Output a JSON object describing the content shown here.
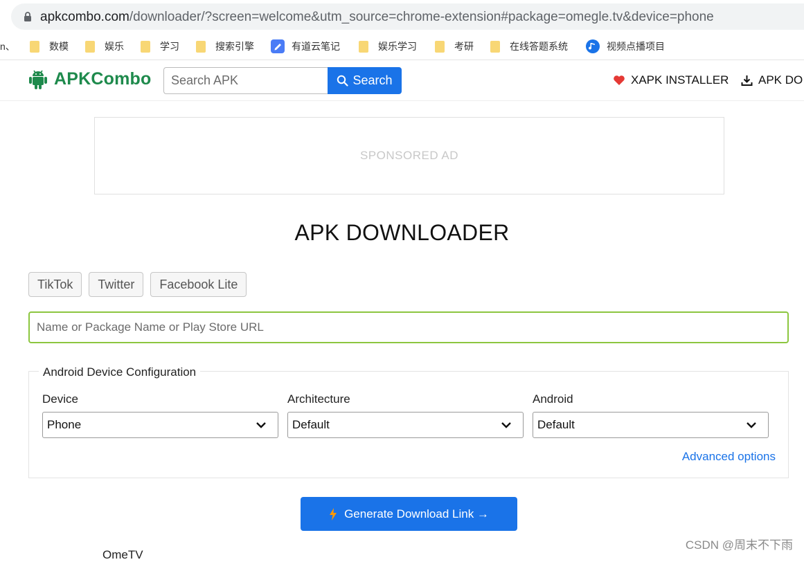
{
  "browser": {
    "url_host": "apkcombo.com",
    "url_rest": "/downloader/?screen=welcome&utm_source=chrome-extension#package=omegle.tv&device=phone",
    "bookmarks_cut": "n、",
    "bookmarks": [
      {
        "label": "数模",
        "icon": "folder-icon"
      },
      {
        "label": "娱乐",
        "icon": "folder-icon"
      },
      {
        "label": "学习",
        "icon": "folder-icon"
      },
      {
        "label": "搜索引擎",
        "icon": "folder-icon"
      },
      {
        "label": "有道云笔记",
        "icon": "note-icon"
      },
      {
        "label": "娱乐学习",
        "icon": "folder-icon"
      },
      {
        "label": "考研",
        "icon": "folder-icon"
      },
      {
        "label": "在线答题系统",
        "icon": "folder-icon"
      },
      {
        "label": "视频点播项目",
        "icon": "video-icon"
      }
    ]
  },
  "header": {
    "logo_text": "APKCombo",
    "search_placeholder": "Search APK",
    "search_button": "Search",
    "xapk_installer": "XAPK INSTALLER",
    "apk_downloader": "APK DO"
  },
  "ad": {
    "label": "SPONSORED AD"
  },
  "main": {
    "title": "APK DOWNLOADER",
    "chips": [
      "TikTok",
      "Twitter",
      "Facebook Lite"
    ],
    "input_placeholder": "Name or Package Name or Play Store URL",
    "config": {
      "legend": "Android Device Configuration",
      "device_label": "Device",
      "device_value": "Phone",
      "arch_label": "Architecture",
      "arch_value": "Default",
      "android_label": "Android",
      "android_value": "Default",
      "advanced": "Advanced options"
    },
    "generate_button": "Generate Download Link →",
    "bottom_cut": "OmeTV"
  },
  "watermark": "CSDN @周末不下雨",
  "colors": {
    "brand_green": "#1e8a4c",
    "primary_blue": "#1a73e8",
    "input_focus": "#8cc63f",
    "heart_red": "#e53935"
  }
}
